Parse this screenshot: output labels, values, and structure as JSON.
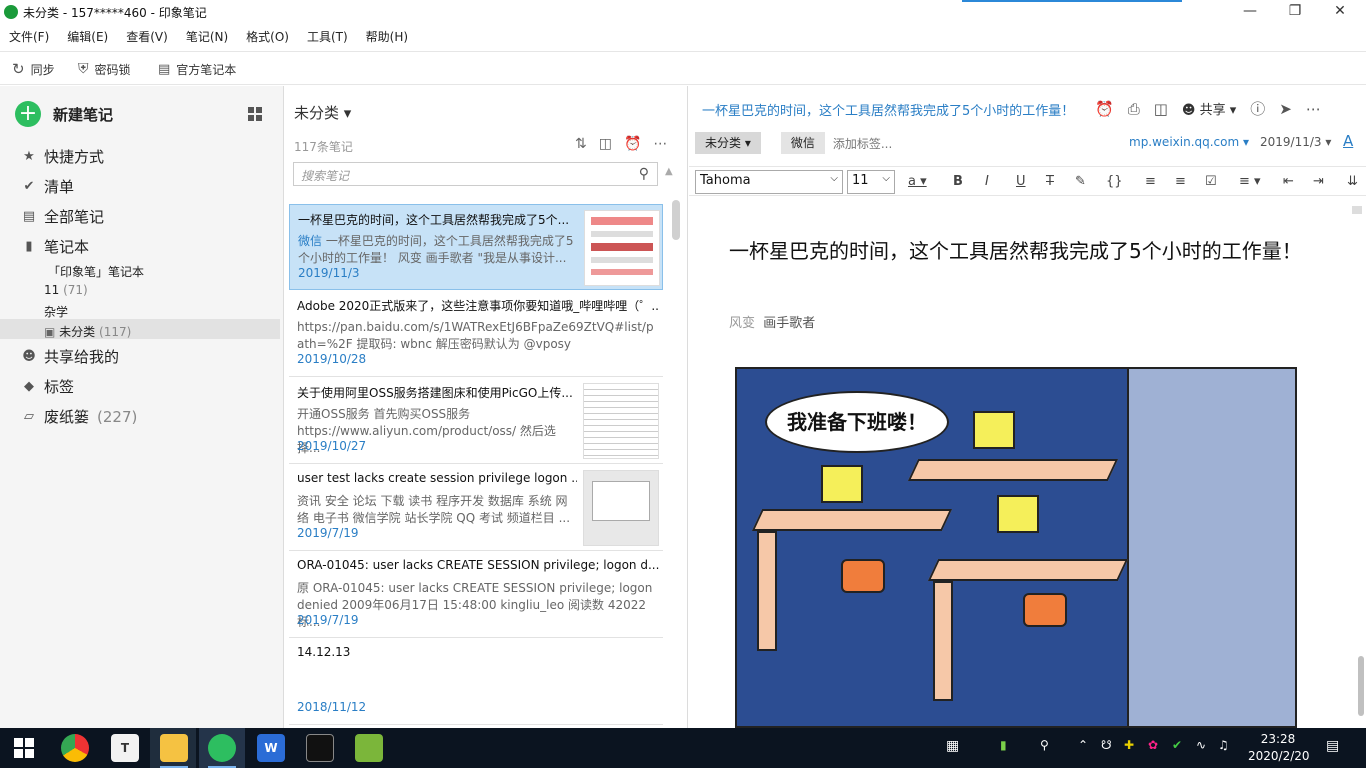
{
  "window": {
    "title": "未分类 - 157*****460 - 印象笔记"
  },
  "menu": [
    "文件(F)",
    "编辑(E)",
    "查看(V)",
    "笔记(N)",
    "格式(O)",
    "工具(T)",
    "帮助(H)"
  ],
  "toolbar": {
    "sync": "同步",
    "lock": "密码锁",
    "official": "官方笔记本"
  },
  "sidebar": {
    "new_note": "新建笔记",
    "shortcuts": "快捷方式",
    "checklist": "清单",
    "all_notes": "全部笔记",
    "notebooks": "笔记本",
    "nb_yinxiang": "「印象笔」笔记本",
    "nb_11": "11",
    "nb_11_count": "(71)",
    "nb_zaxue": "杂学",
    "nb_unsorted": "未分类",
    "nb_unsorted_count": "(117)",
    "shared": "共享给我的",
    "tags": "标签",
    "trash": "废纸篓",
    "trash_count": "(227)"
  },
  "list": {
    "header": "未分类 ▾",
    "count": "117条笔记",
    "search_placeholder": "搜索笔记",
    "notes": [
      {
        "title": "一杯星巴克的时间，这个工具居然帮我完成了5个...",
        "source": "微信",
        "snippet": "一杯星巴克的时间，这个工具居然帮我完成了5个小时的工作量！ 风变 画手歌者 \"我是从事设计...",
        "date": "2019/11/3"
      },
      {
        "title": "Adobe 2020正式版来了，这些注意事项你要知道哦_哔哩哔哩（゜...",
        "snippet": "https://pan.baidu.com/s/1WATRexEtJ6BFpaZe69ZtVQ#list/path=%2F 提取码: wbnc 解压密码默认为 @vposy",
        "date": "2019/10/28"
      },
      {
        "title": "关于使用阿里OSS服务搭建图床和使用PicGO上传...",
        "snippet": "开通OSS服务 首先购买OSS服务 https://www.aliyun.com/product/oss/ 然后选择...",
        "date": "2019/10/27"
      },
      {
        "title": "user test lacks create session privilege logon ...",
        "snippet": "资讯 安全 论坛 下载 读书 程序开发 数据库 系统 网络 电子书 微信学院 站长学院 QQ 考试 频道栏目 ...",
        "date": "2019/7/19"
      },
      {
        "title": "ORA-01045: user lacks CREATE SESSION privilege; logon d...",
        "snippet": "原 ORA-01045: user lacks CREATE SESSION privilege; logon denied 2009年06月17日 15:48:00 kingliu_leo 阅读数 42022 标...",
        "date": "2019/7/19"
      },
      {
        "title": "14.12.13",
        "snippet": "",
        "date": "2018/11/12"
      }
    ]
  },
  "editor": {
    "top_title": "一杯星巴克的时间，这个工具居然帮我完成了5个小时的工作量！",
    "share": "共享",
    "notebook_chip": "未分类 ▾",
    "tag_chip": "微信",
    "add_tag": "添加标签...",
    "source_url": "mp.weixin.qq.com ▾",
    "date": "2019/11/3 ▾",
    "font": "Tahoma",
    "size": "11",
    "doc_title": "一杯星巴克的时间，这个工具居然帮我完成了5个小时的工作量！",
    "author_prefix": "风变",
    "author_link": "画手歌者",
    "comic_bubble": "我准备下班喽！"
  },
  "taskbar": {
    "time": "23:28",
    "date": "2020/2/20"
  }
}
